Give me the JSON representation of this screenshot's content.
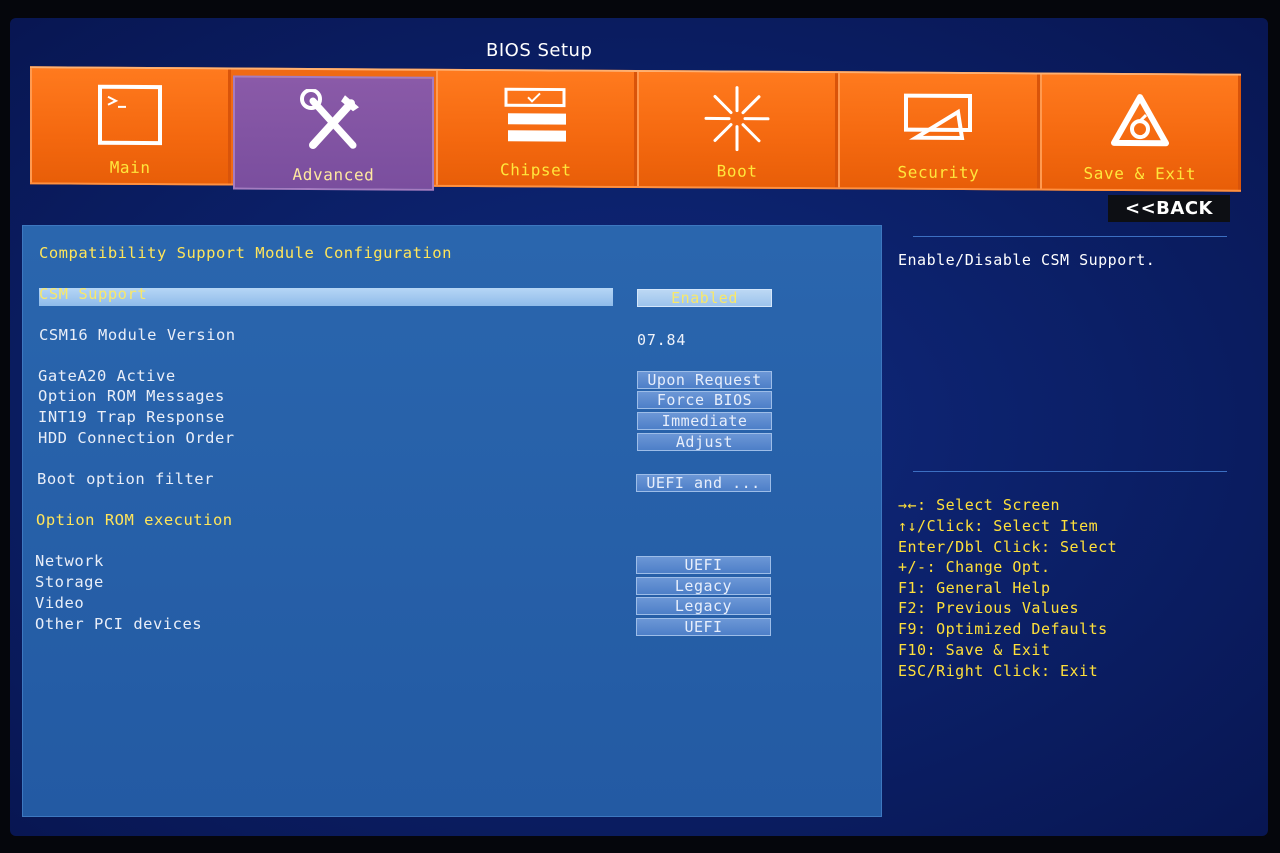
{
  "window": {
    "title": "BIOS Setup"
  },
  "tabs": [
    {
      "label": "Main",
      "icon": "terminal-icon",
      "active": false
    },
    {
      "label": "Advanced",
      "icon": "tools-icon",
      "active": true
    },
    {
      "label": "Chipset",
      "icon": "chipset-icon",
      "active": false
    },
    {
      "label": "Boot",
      "icon": "boot-star-icon",
      "active": false
    },
    {
      "label": "Security",
      "icon": "security-icon",
      "active": false
    },
    {
      "label": "Save & Exit",
      "icon": "save-exit-icon",
      "active": false
    }
  ],
  "back_button": {
    "label": "<<BACK"
  },
  "main": {
    "heading": "Compatibility Support Module Configuration",
    "csm_support": {
      "label": "CSM Support",
      "value": "Enabled"
    },
    "csm16_version": {
      "label": "CSM16 Module Version",
      "value": "07.84"
    },
    "settings": [
      {
        "label": "GateA20 Active",
        "value": "Upon Request"
      },
      {
        "label": "Option ROM Messages",
        "value": "Force BIOS"
      },
      {
        "label": "INT19 Trap Response",
        "value": "Immediate"
      },
      {
        "label": "HDD Connection Order",
        "value": "Adjust"
      }
    ],
    "boot_filter": {
      "label": "Boot option filter",
      "value": "UEFI and ..."
    },
    "option_rom_heading": "Option ROM execution",
    "option_rom": [
      {
        "label": "Network",
        "value": "UEFI"
      },
      {
        "label": "Storage",
        "value": "Legacy"
      },
      {
        "label": "Video",
        "value": "Legacy"
      },
      {
        "label": "Other PCI devices",
        "value": "UEFI"
      }
    ]
  },
  "help": {
    "description": "Enable/Disable CSM Support.",
    "keys": [
      "→←: Select Screen",
      "↑↓/Click: Select Item",
      "Enter/Dbl Click: Select",
      "+/-: Change Opt.",
      "F1: General Help",
      "F2: Previous Values",
      "F9: Optimized Defaults",
      "F10: Save & Exit",
      "ESC/Right Click: Exit"
    ]
  },
  "colors": {
    "tab_orange": "#f4680f",
    "tab_active": "#7a4e9e",
    "panel_blue": "#235aa3",
    "background": "#0b1f66",
    "highlight_text": "#ffe55a"
  }
}
